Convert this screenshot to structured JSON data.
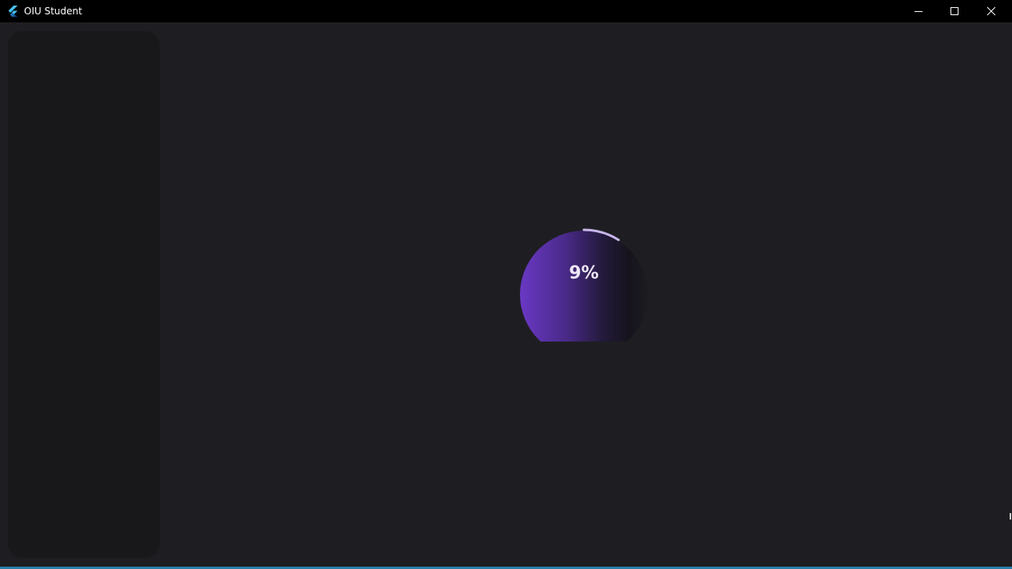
{
  "window": {
    "title": "OIU Student",
    "controls": {
      "minimize": "minimize-icon",
      "maximize": "maximize-icon",
      "close": "close-icon"
    }
  },
  "loader": {
    "progress_text": "9%",
    "progress_value": 9
  },
  "colors": {
    "titlebar_bg": "#000000",
    "content_bg": "#1e1e22",
    "sidebar_bg": "#18181a",
    "accent_purple": "#6a38c4",
    "arc_color": "#c7b6ea"
  }
}
